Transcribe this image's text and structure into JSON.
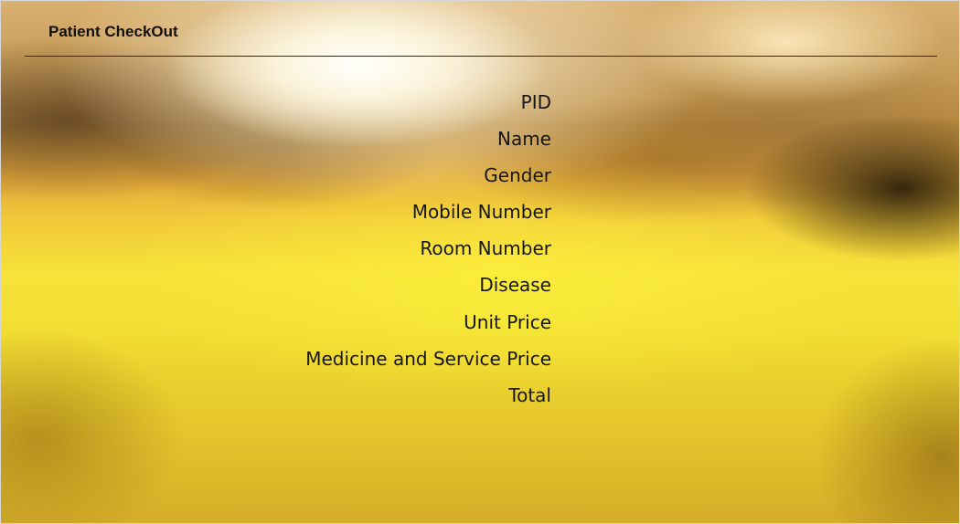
{
  "window": {
    "title": "Patient CheckOut"
  },
  "form": {
    "fields": [
      {
        "label": "PID"
      },
      {
        "label": "Name"
      },
      {
        "label": "Gender"
      },
      {
        "label": "Mobile Number"
      },
      {
        "label": "Room Number"
      },
      {
        "label": "Disease"
      },
      {
        "label": "Unit Price"
      },
      {
        "label": "Medicine and Service Price"
      },
      {
        "label": "Total"
      }
    ]
  },
  "theme": {
    "background_top": "#d9b070",
    "background_mid": "#f6e23a",
    "background_bottom": "#d4ad28",
    "text_color": "#161616",
    "divider_color": "#2a2a2a"
  }
}
